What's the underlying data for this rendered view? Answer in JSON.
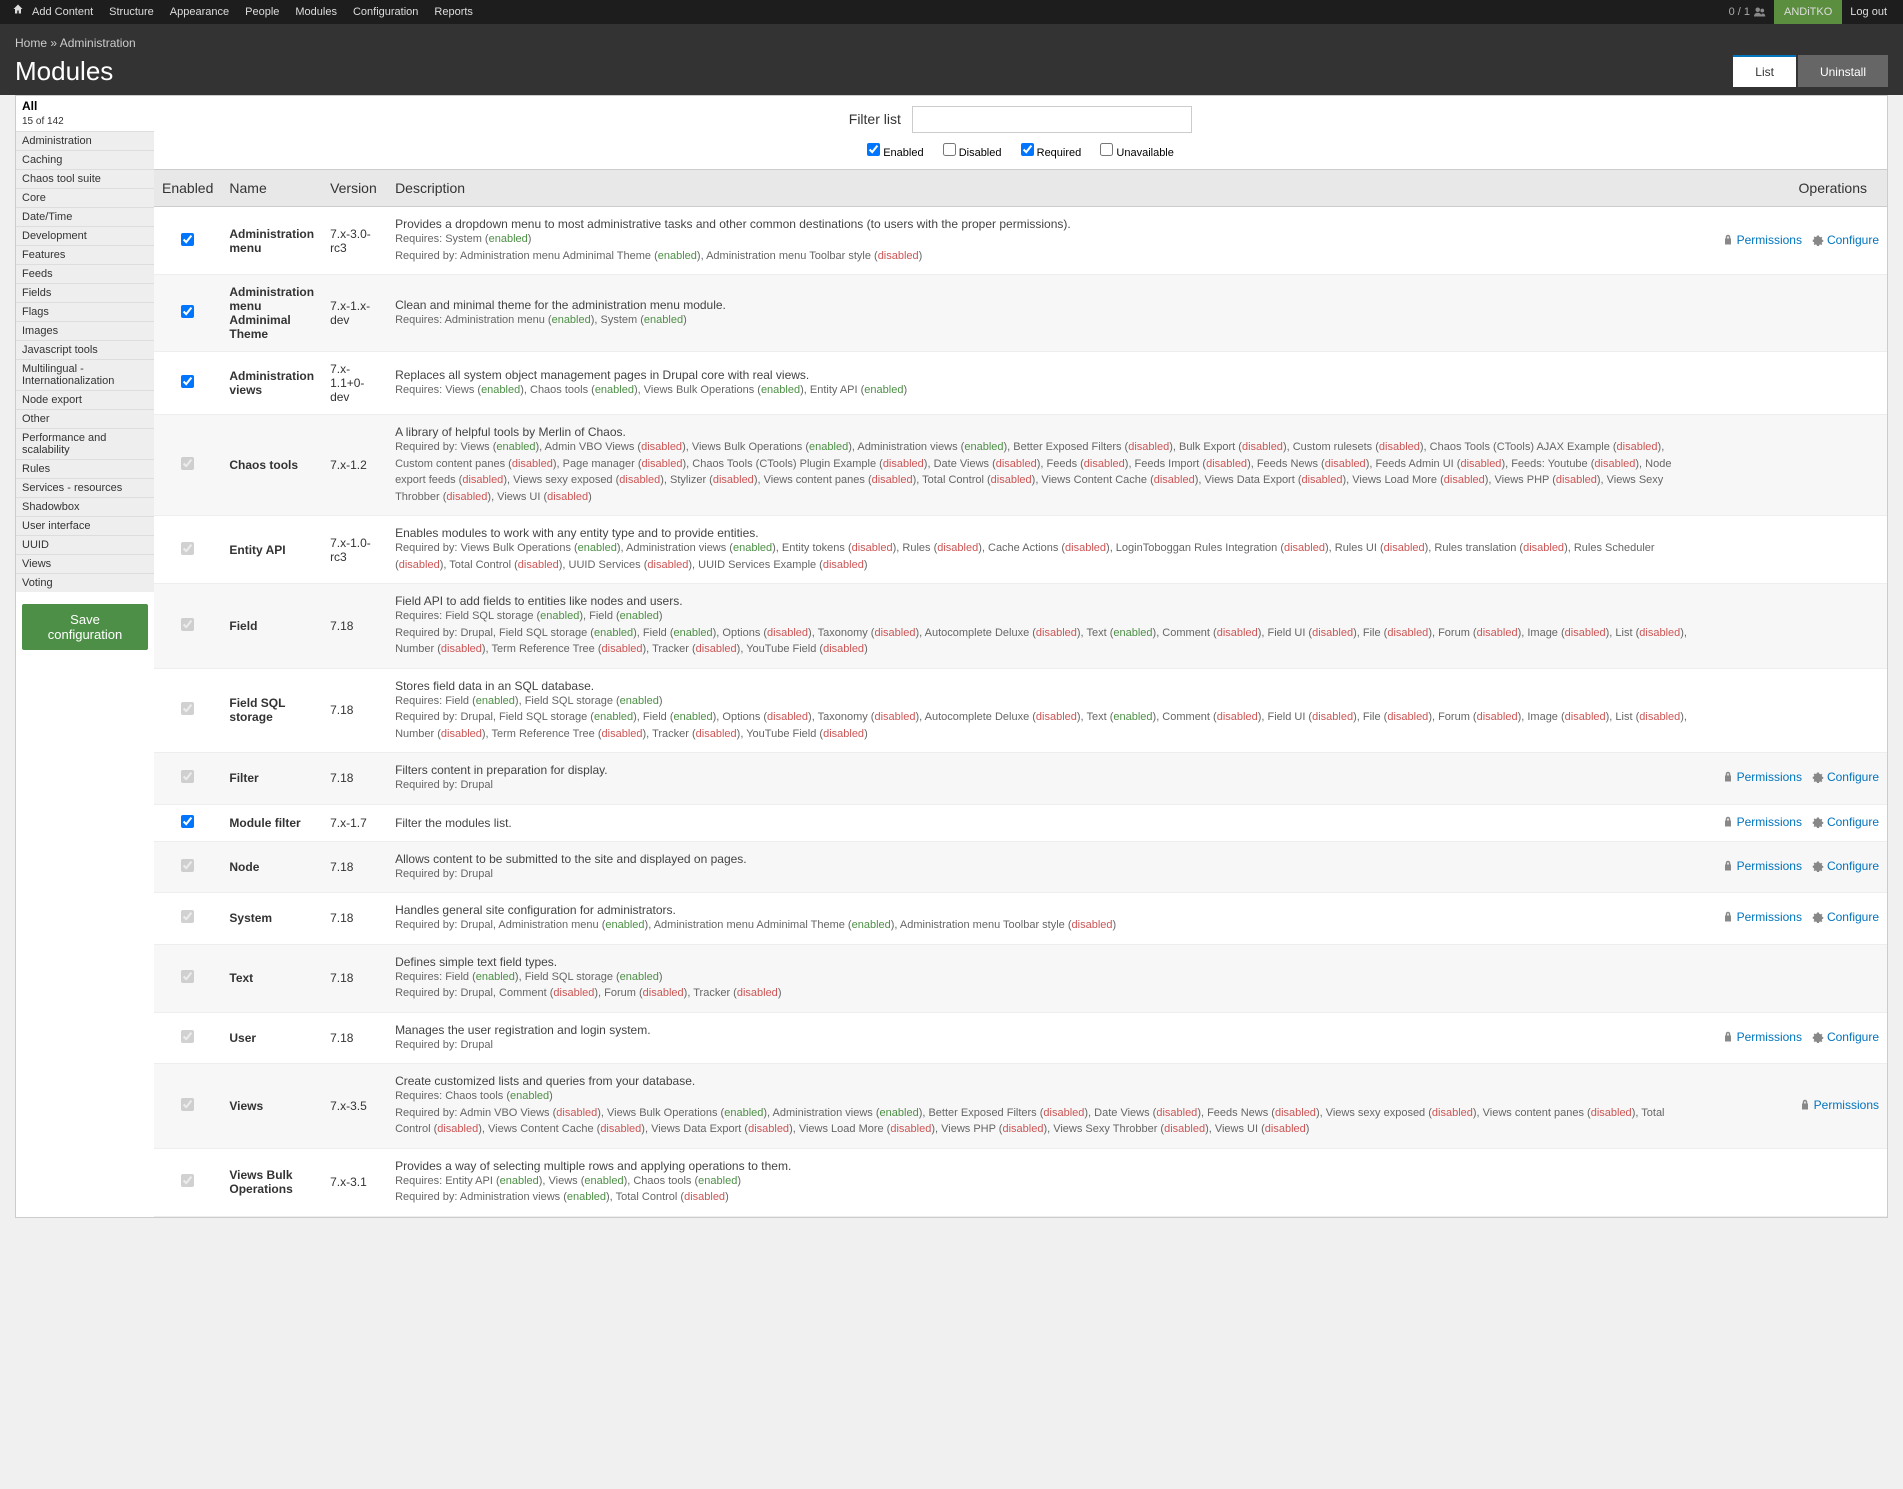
{
  "toolbar": {
    "links": [
      "Add Content",
      "Structure",
      "Appearance",
      "People",
      "Modules",
      "Configuration",
      "Reports"
    ],
    "counter": "0 / 1",
    "user": "ANDiTKO",
    "logout": "Log out"
  },
  "breadcrumb": {
    "home": "Home",
    "sep": " » ",
    "admin": "Administration"
  },
  "page_title": "Modules",
  "tabs": [
    {
      "label": "List",
      "active": true
    },
    {
      "label": "Uninstall",
      "active": false
    }
  ],
  "sidebar": {
    "all_label": "All",
    "count": "15 of 142",
    "items": [
      "Administration",
      "Caching",
      "Chaos tool suite",
      "Core",
      "Date/Time",
      "Development",
      "Features",
      "Feeds",
      "Fields",
      "Flags",
      "Images",
      "Javascript tools",
      "Multilingual - Internationalization",
      "Node export",
      "Other",
      "Performance and scalability",
      "Rules",
      "Services - resources",
      "Shadowbox",
      "User interface",
      "UUID",
      "Views",
      "Voting"
    ],
    "save": "Save configuration"
  },
  "filter": {
    "label": "Filter list",
    "placeholder": "",
    "cb_enabled": "Enabled",
    "cb_disabled": "Disabled",
    "cb_required": "Required",
    "cb_unavailable": "Unavailable"
  },
  "columns": {
    "enabled": "Enabled",
    "name": "Name",
    "version": "Version",
    "description": "Description",
    "operations": "Operations"
  },
  "ops": {
    "permissions": "Permissions",
    "configure": "Configure"
  },
  "rows": [
    {
      "name": "Administration menu",
      "version": "7.x-3.0-rc3",
      "desc": "Provides a dropdown menu to most administrative tasks and other common destinations (to users with the proper permissions).",
      "sub": "Requires: System (<span class='enabled'>enabled</span>)<br>Required by: Administration menu Adminimal Theme (<span class='enabled'>enabled</span>), Administration menu Toolbar style (<span class='disabled'>disabled</span>)",
      "perm": true,
      "conf": true,
      "locked": false
    },
    {
      "name": "Administration menu Adminimal Theme",
      "version": "7.x-1.x-dev",
      "desc": "Clean and minimal theme for the administration menu module.",
      "sub": "Requires: Administration menu (<span class='enabled'>enabled</span>), System (<span class='enabled'>enabled</span>)",
      "locked": false
    },
    {
      "name": "Administration views",
      "version": "7.x-1.1+0-dev",
      "desc": "Replaces all system object management pages in Drupal core with real views.",
      "sub": "Requires: Views (<span class='enabled'>enabled</span>), Chaos tools (<span class='enabled'>enabled</span>), Views Bulk Operations (<span class='enabled'>enabled</span>), Entity API (<span class='enabled'>enabled</span>)",
      "locked": false
    },
    {
      "name": "Chaos tools",
      "version": "7.x-1.2",
      "desc": "A library of helpful tools by Merlin of Chaos.",
      "sub": "Required by: Views (<span class='enabled'>enabled</span>), Admin VBO Views (<span class='disabled'>disabled</span>), Views Bulk Operations (<span class='enabled'>enabled</span>), Administration views (<span class='enabled'>enabled</span>), Better Exposed Filters (<span class='disabled'>disabled</span>), Bulk Export (<span class='disabled'>disabled</span>), Custom rulesets (<span class='disabled'>disabled</span>), Chaos Tools (CTools) AJAX Example (<span class='disabled'>disabled</span>), Custom content panes (<span class='disabled'>disabled</span>), Page manager (<span class='disabled'>disabled</span>), Chaos Tools (CTools) Plugin Example (<span class='disabled'>disabled</span>), Date Views (<span class='disabled'>disabled</span>), Feeds (<span class='disabled'>disabled</span>), Feeds Import (<span class='disabled'>disabled</span>), Feeds News (<span class='disabled'>disabled</span>), Feeds Admin UI (<span class='disabled'>disabled</span>), Feeds: Youtube (<span class='disabled'>disabled</span>), Node export feeds (<span class='disabled'>disabled</span>), Views sexy exposed (<span class='disabled'>disabled</span>), Stylizer (<span class='disabled'>disabled</span>), Views content panes (<span class='disabled'>disabled</span>), Total Control (<span class='disabled'>disabled</span>), Views Content Cache (<span class='disabled'>disabled</span>), Views Data Export (<span class='disabled'>disabled</span>), Views Load More (<span class='disabled'>disabled</span>), Views PHP (<span class='disabled'>disabled</span>), Views Sexy Throbber (<span class='disabled'>disabled</span>), Views UI (<span class='disabled'>disabled</span>)",
      "locked": true
    },
    {
      "name": "Entity API",
      "version": "7.x-1.0-rc3",
      "desc": "Enables modules to work with any entity type and to provide entities.",
      "sub": "Required by: Views Bulk Operations (<span class='enabled'>enabled</span>), Administration views (<span class='enabled'>enabled</span>), Entity tokens (<span class='disabled'>disabled</span>), Rules (<span class='disabled'>disabled</span>), Cache Actions (<span class='disabled'>disabled</span>), LoginToboggan Rules Integration (<span class='disabled'>disabled</span>), Rules UI (<span class='disabled'>disabled</span>), Rules translation (<span class='disabled'>disabled</span>), Rules Scheduler (<span class='disabled'>disabled</span>), Total Control (<span class='disabled'>disabled</span>), UUID Services (<span class='disabled'>disabled</span>), UUID Services Example (<span class='disabled'>disabled</span>)",
      "locked": true
    },
    {
      "name": "Field",
      "version": "7.18",
      "desc": "Field API to add fields to entities like nodes and users.",
      "sub": "Requires: Field SQL storage (<span class='enabled'>enabled</span>), Field (<span class='enabled'>enabled</span>)<br>Required by: Drupal, Field SQL storage (<span class='enabled'>enabled</span>), Field (<span class='enabled'>enabled</span>), Options (<span class='disabled'>disabled</span>), Taxonomy (<span class='disabled'>disabled</span>), Autocomplete Deluxe (<span class='disabled'>disabled</span>), Text (<span class='enabled'>enabled</span>), Comment (<span class='disabled'>disabled</span>), Field UI (<span class='disabled'>disabled</span>), File (<span class='disabled'>disabled</span>), Forum (<span class='disabled'>disabled</span>), Image (<span class='disabled'>disabled</span>), List (<span class='disabled'>disabled</span>), Number (<span class='disabled'>disabled</span>), Term Reference Tree (<span class='disabled'>disabled</span>), Tracker (<span class='disabled'>disabled</span>), YouTube Field (<span class='disabled'>disabled</span>)",
      "locked": true
    },
    {
      "name": "Field SQL storage",
      "version": "7.18",
      "desc": "Stores field data in an SQL database.",
      "sub": "Requires: Field (<span class='enabled'>enabled</span>), Field SQL storage (<span class='enabled'>enabled</span>)<br>Required by: Drupal, Field SQL storage (<span class='enabled'>enabled</span>), Field (<span class='enabled'>enabled</span>), Options (<span class='disabled'>disabled</span>), Taxonomy (<span class='disabled'>disabled</span>), Autocomplete Deluxe (<span class='disabled'>disabled</span>), Text (<span class='enabled'>enabled</span>), Comment (<span class='disabled'>disabled</span>), Field UI (<span class='disabled'>disabled</span>), File (<span class='disabled'>disabled</span>), Forum (<span class='disabled'>disabled</span>), Image (<span class='disabled'>disabled</span>), List (<span class='disabled'>disabled</span>), Number (<span class='disabled'>disabled</span>), Term Reference Tree (<span class='disabled'>disabled</span>), Tracker (<span class='disabled'>disabled</span>), YouTube Field (<span class='disabled'>disabled</span>)",
      "locked": true
    },
    {
      "name": "Filter",
      "version": "7.18",
      "desc": "Filters content in preparation for display.",
      "sub": "Required by: Drupal",
      "perm": true,
      "conf": true,
      "locked": true
    },
    {
      "name": "Module filter",
      "version": "7.x-1.7",
      "desc": "Filter the modules list.",
      "sub": "",
      "perm": true,
      "conf": true,
      "locked": false
    },
    {
      "name": "Node",
      "version": "7.18",
      "desc": "Allows content to be submitted to the site and displayed on pages.",
      "sub": "Required by: Drupal",
      "perm": true,
      "conf": true,
      "locked": true
    },
    {
      "name": "System",
      "version": "7.18",
      "desc": "Handles general site configuration for administrators.",
      "sub": "Required by: Drupal, Administration menu (<span class='enabled'>enabled</span>), Administration menu Adminimal Theme (<span class='enabled'>enabled</span>), Administration menu Toolbar style (<span class='disabled'>disabled</span>)",
      "perm": true,
      "conf": true,
      "locked": true
    },
    {
      "name": "Text",
      "version": "7.18",
      "desc": "Defines simple text field types.",
      "sub": "Requires: Field (<span class='enabled'>enabled</span>), Field SQL storage (<span class='enabled'>enabled</span>)<br>Required by: Drupal, Comment (<span class='disabled'>disabled</span>), Forum (<span class='disabled'>disabled</span>), Tracker (<span class='disabled'>disabled</span>)",
      "locked": true
    },
    {
      "name": "User",
      "version": "7.18",
      "desc": "Manages the user registration and login system.",
      "sub": "Required by: Drupal",
      "perm": true,
      "conf": true,
      "locked": true
    },
    {
      "name": "Views",
      "version": "7.x-3.5",
      "desc": "Create customized lists and queries from your database.",
      "sub": "Requires: Chaos tools (<span class='enabled'>enabled</span>)<br>Required by: Admin VBO Views (<span class='disabled'>disabled</span>), Views Bulk Operations (<span class='enabled'>enabled</span>), Administration views (<span class='enabled'>enabled</span>), Better Exposed Filters (<span class='disabled'>disabled</span>), Date Views (<span class='disabled'>disabled</span>), Feeds News (<span class='disabled'>disabled</span>), Views sexy exposed (<span class='disabled'>disabled</span>), Views content panes (<span class='disabled'>disabled</span>), Total Control (<span class='disabled'>disabled</span>), Views Content Cache (<span class='disabled'>disabled</span>), Views Data Export (<span class='disabled'>disabled</span>), Views Load More (<span class='disabled'>disabled</span>), Views PHP (<span class='disabled'>disabled</span>), Views Sexy Throbber (<span class='disabled'>disabled</span>), Views UI (<span class='disabled'>disabled</span>)",
      "perm": true,
      "locked": true
    },
    {
      "name": "Views Bulk Operations",
      "version": "7.x-3.1",
      "desc": "Provides a way of selecting multiple rows and applying operations to them.",
      "sub": "Requires: Entity API (<span class='enabled'>enabled</span>), Views (<span class='enabled'>enabled</span>), Chaos tools (<span class='enabled'>enabled</span>)<br>Required by: Administration views (<span class='enabled'>enabled</span>), Total Control (<span class='disabled'>disabled</span>)",
      "locked": true
    }
  ]
}
